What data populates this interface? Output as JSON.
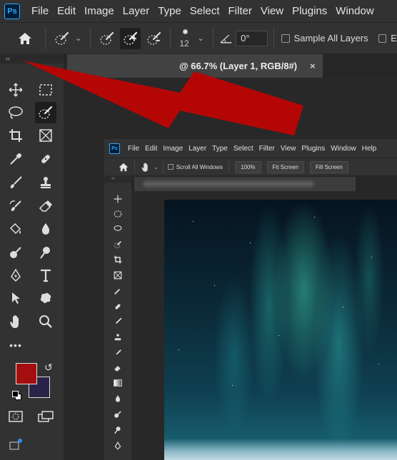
{
  "app": {
    "logo_text": "Ps"
  },
  "menu": [
    "File",
    "Edit",
    "Image",
    "Layer",
    "Type",
    "Select",
    "Filter",
    "View",
    "Plugins",
    "Window"
  ],
  "options": {
    "brush_size": "12",
    "angle_value": "0°",
    "sample_all_layers_label": "Sample All Layers",
    "truncated_label": "E"
  },
  "toolbar": {
    "collapse_glyph": "‹‹",
    "more_glyph": "•••"
  },
  "document_tab": {
    "title": "@ 66.7% (Layer 1, RGB/8#)",
    "close_glyph": "×"
  },
  "colors": {
    "foreground": "#a40e0e",
    "background": "#2b2347",
    "arrow": "#b50606"
  },
  "inner": {
    "logo_text": "Ps",
    "menu": [
      "File",
      "Edit",
      "Image",
      "Layer",
      "Type",
      "Select",
      "Filter",
      "View",
      "Plugins",
      "Window",
      "Help"
    ],
    "scroll_all_windows_label": "Scroll All Windows",
    "zoom_button": "100%",
    "fit_screen_button": "Fit Screen",
    "fill_screen_button": "Fill Screen",
    "collapse_glyph": "‹‹"
  }
}
